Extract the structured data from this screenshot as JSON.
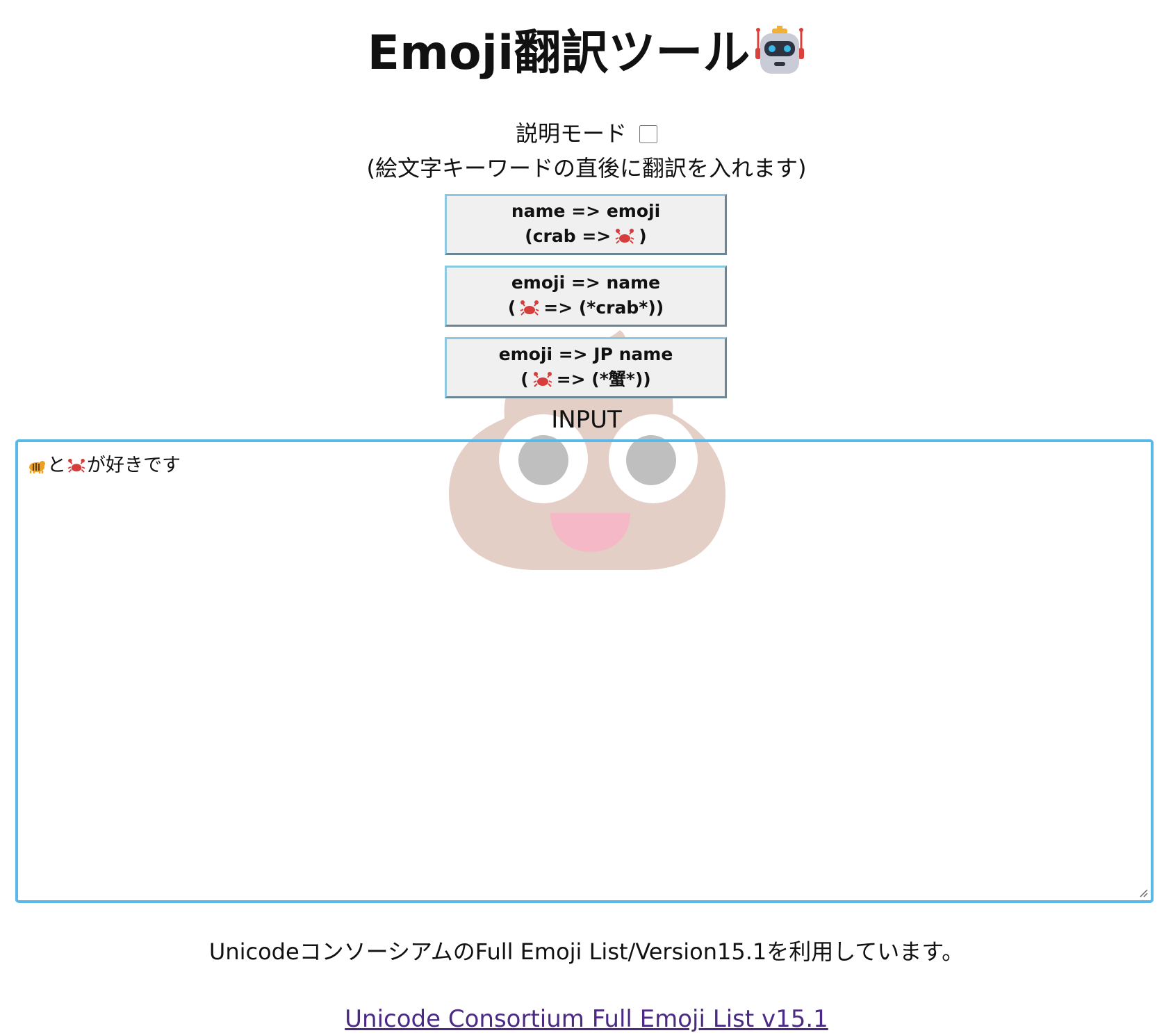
{
  "header": {
    "title": "Emoji翻訳ツール",
    "title_icon": "robot-face-icon"
  },
  "mode": {
    "label": "説明モード",
    "checked": false,
    "note": "(絵文字キーワードの直後に翻訳を入れます)"
  },
  "buttons": [
    {
      "line1": "name => emoji",
      "line2_prefix": "(crab =>",
      "line2_icon": "crab-icon",
      "line2_suffix": ")"
    },
    {
      "line1": "emoji => name",
      "line2_prefix": "(",
      "line2_icon": "crab-icon",
      "line2_suffix": "=> (*crab*))"
    },
    {
      "line1": "emoji => JP name",
      "line2_prefix": "(",
      "line2_icon": "crab-icon",
      "line2_suffix": "=> (*蟹*))"
    }
  ],
  "background_icon": "pile-of-poo-icon",
  "input": {
    "label": "INPUT",
    "value_parts": {
      "icon1": "tiger-icon",
      "text1": "と",
      "icon2": "crab-icon",
      "text2": "が好きです"
    }
  },
  "footer": {
    "note": "UnicodeコンソーシアムのFull Emoji List/Version15.1を利用しています。",
    "link_text": "Unicode Consortium Full Emoji List v15.1"
  },
  "colors": {
    "input_border": "#5ab8e8",
    "button_bg": "#f0f0f0",
    "link": "#4b2a86",
    "poo_body": "#e3cfc6"
  }
}
